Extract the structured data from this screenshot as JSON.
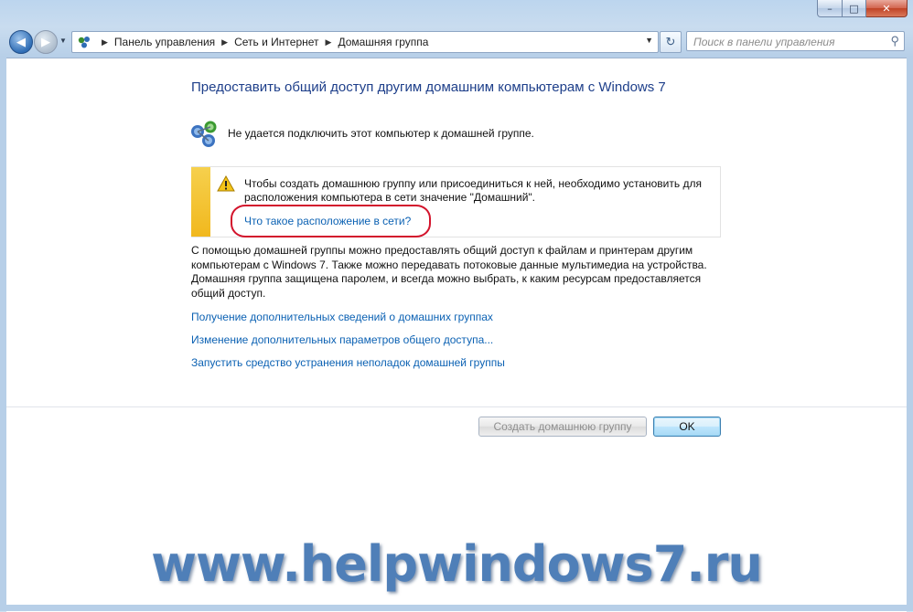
{
  "window": {
    "caption": {
      "minimize": "–",
      "maximize": "□",
      "close": "✕"
    }
  },
  "nav": {
    "back_icon": "arrow-left-icon",
    "forward_icon": "arrow-right-icon",
    "breadcrumb": [
      "Панель управления",
      "Сеть и Интернет",
      "Домашняя группа"
    ],
    "search_placeholder": "Поиск в панели управления"
  },
  "main": {
    "heading": "Предоставить общий доступ другим домашним компьютерам с Windows 7",
    "status_text": "Не удается подключить этот компьютер к домашней группе.",
    "warning": {
      "text": "Чтобы создать домашнюю группу или присоединиться к ней, необходимо установить для расположения компьютера в сети значение \"Домашний\".",
      "link": "Что такое расположение в сети?"
    },
    "description": "С помощью домашней группы можно предоставлять общий доступ к файлам и принтерам другим компьютерам с Windows 7. Также можно передавать потоковые данные мультимедиа на устройства. Домашняя группа защищена паролем, и всегда можно выбрать, к каким ресурсам предоставляется общий доступ.",
    "links": [
      "Получение дополнительных сведений о домашних группах",
      "Изменение дополнительных параметров общего доступа...",
      "Запустить средство устранения неполадок домашней группы"
    ],
    "buttons": {
      "create": "Создать домашнюю группу",
      "ok": "OK"
    }
  },
  "watermark": "www.helpwindows7.ru",
  "colors": {
    "link": "#0b61b3",
    "heading": "#1e3f8a",
    "warning_bar": "#f1b81e",
    "highlight_circle": "#d3142c"
  }
}
